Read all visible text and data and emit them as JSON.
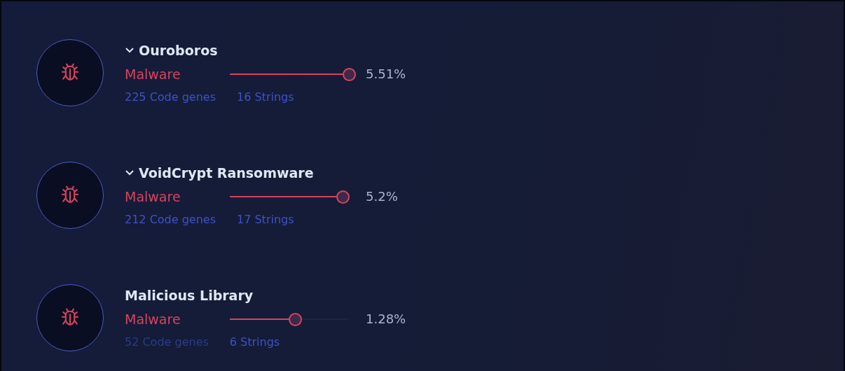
{
  "families": [
    {
      "name": "Ouroboros",
      "expandable": true,
      "category": "Malware",
      "level": 1,
      "percent": "5.51%",
      "code_genes": {
        "label": "225 Code genes",
        "dim": false
      },
      "strings": {
        "label": "16 Strings",
        "dim": false
      }
    },
    {
      "name": "VoidCrypt Ransomware",
      "expandable": true,
      "category": "Malware",
      "level": 0.95,
      "percent": "5.2%",
      "code_genes": {
        "label": "212 Code genes",
        "dim": false
      },
      "strings": {
        "label": "17 Strings",
        "dim": false
      }
    },
    {
      "name": "Malicious Library",
      "expandable": false,
      "category": "Malware",
      "level": 0.55,
      "percent": "1.28%",
      "code_genes": {
        "label": "52 Code genes",
        "dim": true
      },
      "strings": {
        "label": "6 Strings",
        "dim": false
      }
    }
  ]
}
